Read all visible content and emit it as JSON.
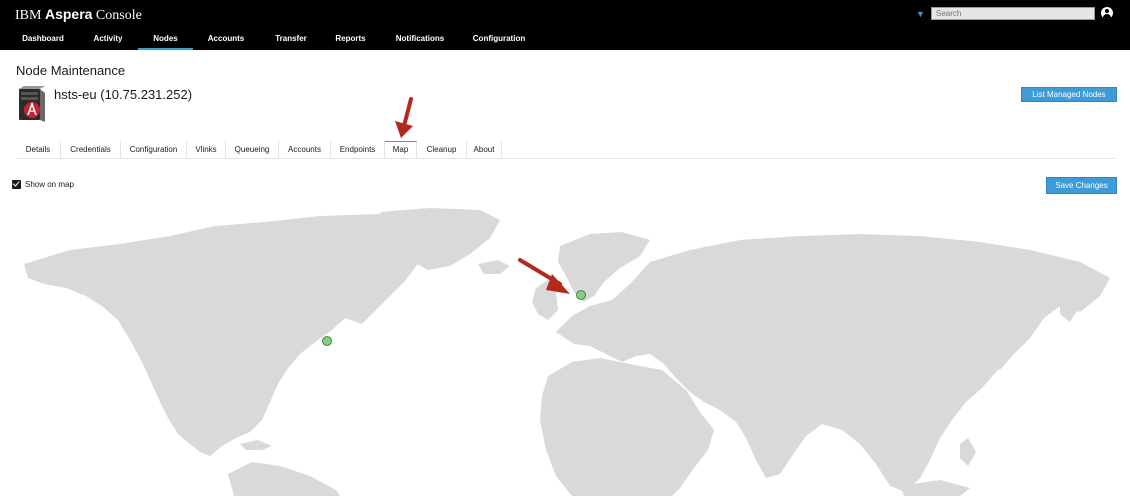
{
  "header": {
    "brand_prefix": "IBM",
    "brand_name": "Aspera",
    "brand_suffix": "Console",
    "search_placeholder": "Search",
    "user_icon": "user-avatar-icon"
  },
  "nav": {
    "items": [
      {
        "label": "Dashboard"
      },
      {
        "label": "Activity"
      },
      {
        "label": "Nodes",
        "active": true
      },
      {
        "label": "Accounts"
      },
      {
        "label": "Transfer"
      },
      {
        "label": "Reports"
      },
      {
        "label": "Notifications"
      },
      {
        "label": "Configuration"
      }
    ]
  },
  "page": {
    "title": "Node Maintenance",
    "node_name": "hsts-eu (10.75.231.252)",
    "list_button": "List Managed Nodes",
    "save_button": "Save Changes"
  },
  "tabs": [
    {
      "label": "Details"
    },
    {
      "label": "Credentials"
    },
    {
      "label": "Configuration"
    },
    {
      "label": "Vlinks"
    },
    {
      "label": "Queueing"
    },
    {
      "label": "Accounts"
    },
    {
      "label": "Endpoints"
    },
    {
      "label": "Map",
      "active": true
    },
    {
      "label": "Cleanup"
    },
    {
      "label": "About"
    }
  ],
  "map": {
    "show_on_map_label": "Show on map",
    "show_on_map_checked": true,
    "markers": [
      "north-america-east",
      "scandinavia"
    ],
    "colors": {
      "land": "#d9d9d9",
      "marker": "#7fd17f",
      "annotation_arrow": "#b22a1e",
      "accent": "#3d9bd9"
    }
  }
}
